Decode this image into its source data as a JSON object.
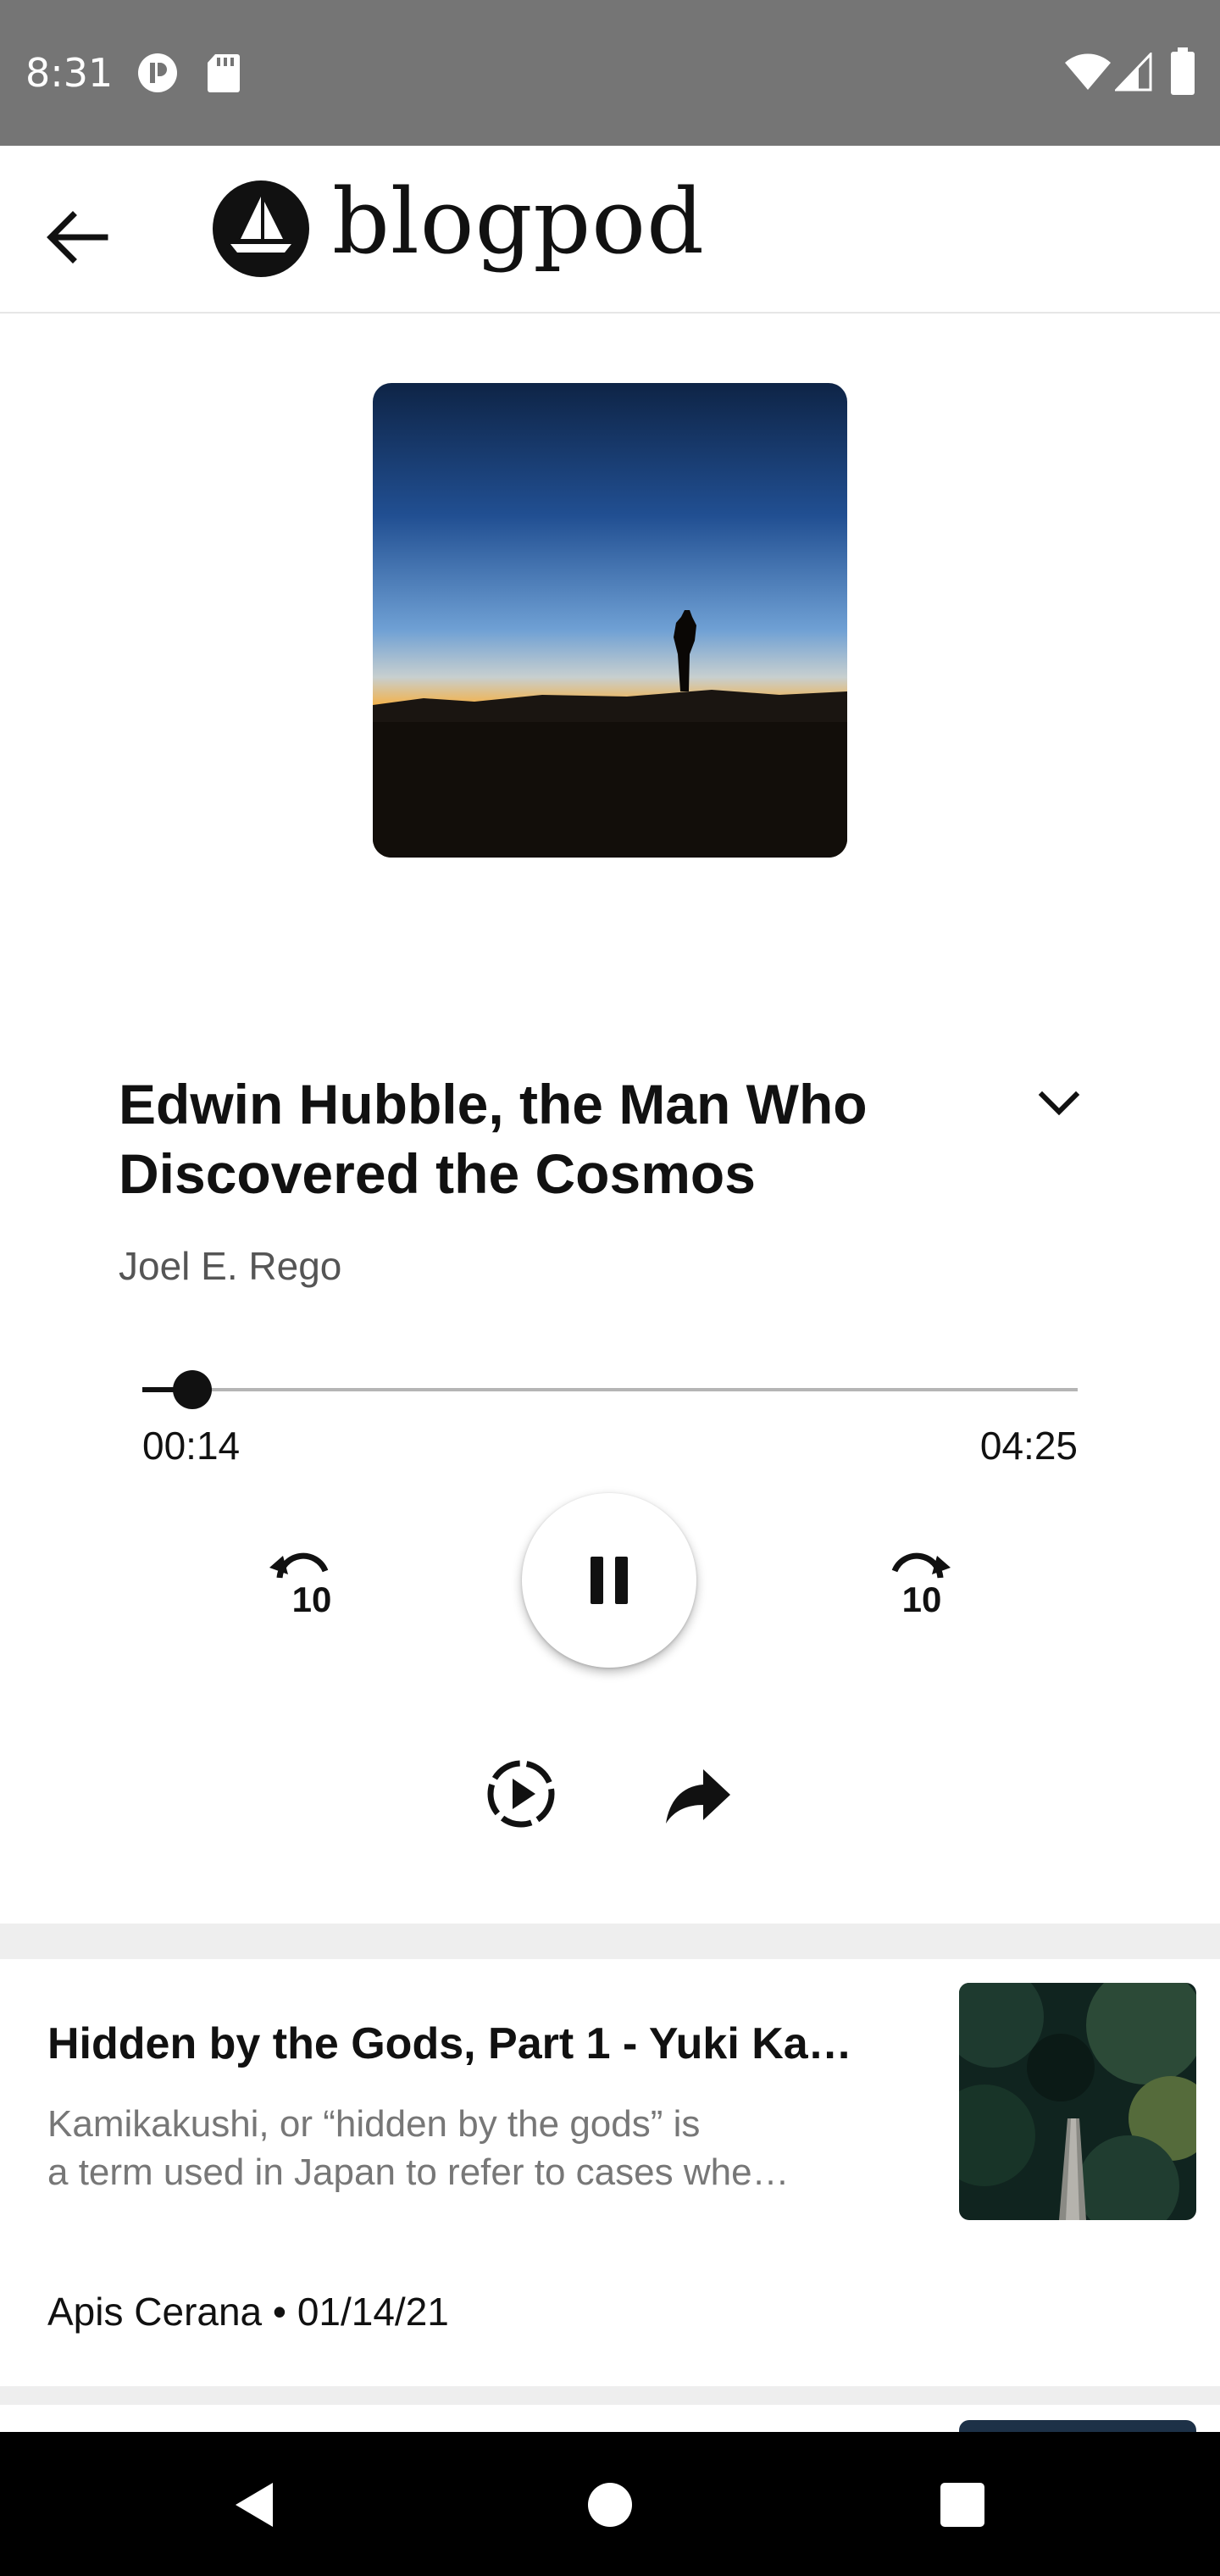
{
  "status_bar": {
    "time": "8:31",
    "left_icons": [
      "p-app-icon",
      "sd-card-icon"
    ],
    "right_icons": [
      "wifi-icon",
      "cellular-signal-icon",
      "battery-icon"
    ]
  },
  "app_bar": {
    "back_icon": "arrow-left-icon",
    "logo_icon": "sailboat-logo-icon",
    "logo_text": "blogpod"
  },
  "player": {
    "title": "Edwin Hubble, the Man Who Discovered the Cosmos",
    "author": "Joel E. Rego",
    "elapsed": "00:14",
    "duration": "04:25",
    "progress_fraction": 0.053,
    "rewind_seconds": "10",
    "forward_seconds": "10",
    "state": "playing",
    "colors": {
      "accent": "#111111",
      "track": "#b5b5b5"
    }
  },
  "queue": [
    {
      "title": "Hidden by the Gods, Part 1 - Yuki Ka…",
      "description_lines": [
        "Kamikakushi, or “hidden by the gods” is",
        "a term used in Japan to refer to cases whe…"
      ],
      "author": "Apis Cerana",
      "date": "01/14/21",
      "separator": " • "
    }
  ],
  "nav_bar": {
    "icons": [
      "back-triangle-icon",
      "home-circle-icon",
      "recents-square-icon"
    ]
  }
}
